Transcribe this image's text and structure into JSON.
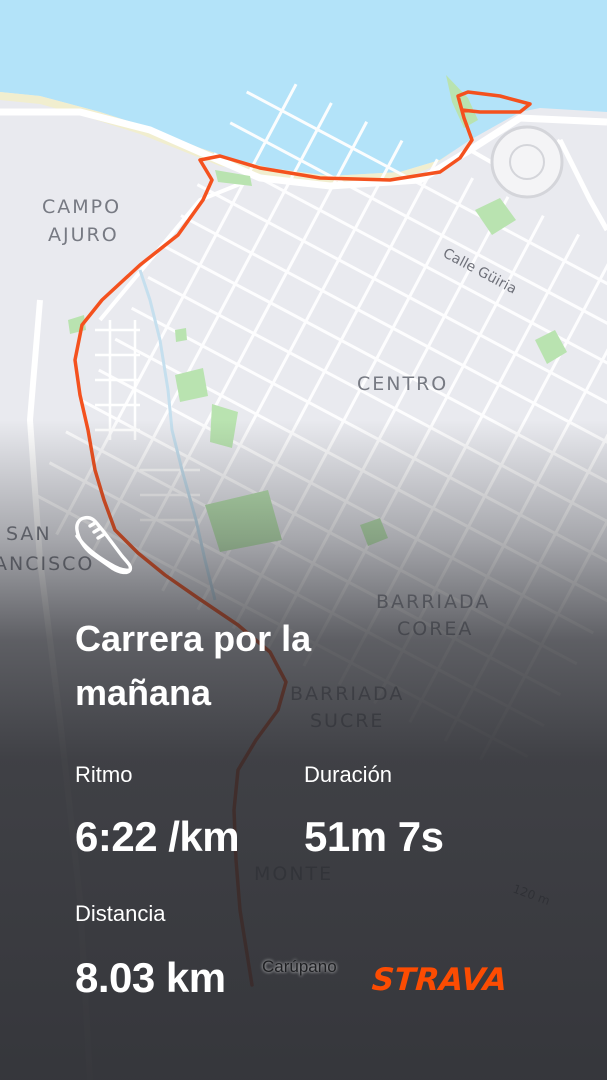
{
  "map": {
    "labels": {
      "campo_line1": "CAMPO",
      "campo_line2": "AJURO",
      "centro": "CENTRO",
      "san": "SAN",
      "francisco": "ANCISCO",
      "corea_line1": "BARRIADA",
      "corea_line2": "COREA",
      "sucre_line1": "BARRIADA",
      "sucre_line2": "SUCRE",
      "monte": "MONTE",
      "city": "Carúpano",
      "street": "Calle Güiria",
      "elevation": "120 m"
    },
    "colors": {
      "sea": "#b3e3f9",
      "land": "#e9eaef",
      "park": "#b9e3b0",
      "route": "#f4511e",
      "shore": "#f1eecf"
    }
  },
  "activity": {
    "icon": "running-shoe-icon",
    "title": "Carrera por la mañana",
    "pace_label": "Ritmo",
    "pace_value": "6:22 /km",
    "duration_label": "Duración",
    "duration_value": "51m 7s",
    "distance_label": "Distancia",
    "distance_value": "8.03 km"
  },
  "brand": {
    "name": "STRAVA",
    "color": "#fc4c02"
  }
}
